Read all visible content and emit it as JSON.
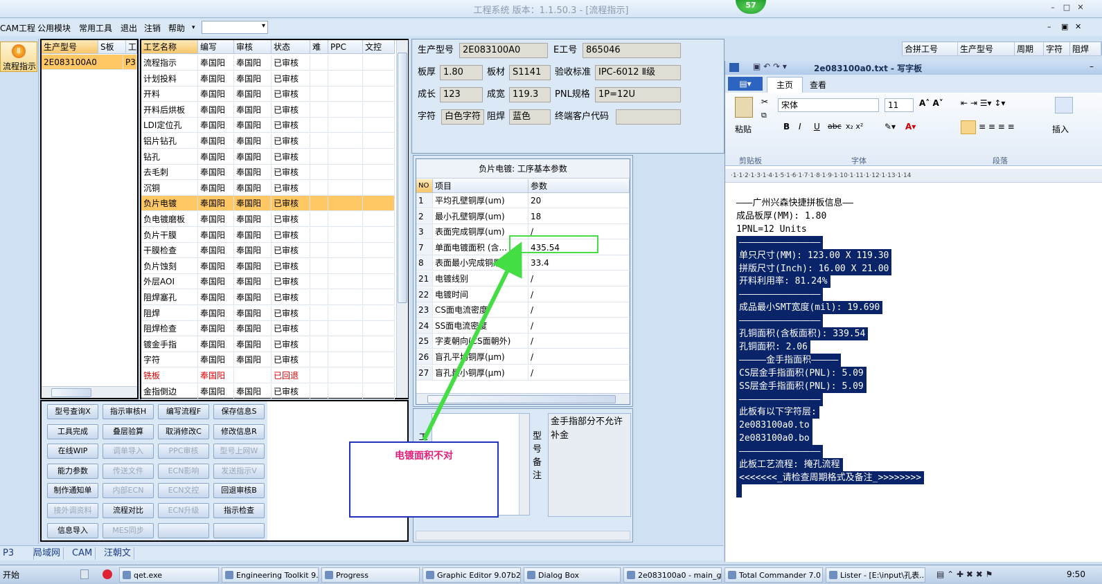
{
  "window": {
    "title": "工程系统   版本：1.1.50.3 - [流程指示]",
    "badge": "57"
  },
  "menu": {
    "items": [
      "CAM工程",
      "公用模块",
      "常用工具",
      "退出",
      "注销",
      "帮助"
    ],
    "combo_value": ""
  },
  "left_toolbar": {
    "flow_label": "流程指示"
  },
  "model_list": {
    "headers": [
      "生产型号",
      "S板",
      "工"
    ],
    "rows": [
      {
        "model": "2E083100A0",
        "s": "",
        "w": "P3"
      }
    ]
  },
  "process_table": {
    "headers": [
      "工艺名称",
      "编写",
      "审核",
      "状态",
      "难",
      "PPC",
      "文控"
    ],
    "rows": [
      {
        "name": "流程指示",
        "author": "奉国阳",
        "reviewer": "奉国阳",
        "status": "已审核"
      },
      {
        "name": "计划投料",
        "author": "奉国阳",
        "reviewer": "奉国阳",
        "status": "已审核"
      },
      {
        "name": "开料",
        "author": "奉国阳",
        "reviewer": "奉国阳",
        "status": "已审核"
      },
      {
        "name": "开料后烘板",
        "author": "奉国阳",
        "reviewer": "奉国阳",
        "status": "已审核"
      },
      {
        "name": "LDI定位孔",
        "author": "奉国阳",
        "reviewer": "奉国阳",
        "status": "已审核"
      },
      {
        "name": "铝片钻孔",
        "author": "奉国阳",
        "reviewer": "奉国阳",
        "status": "已审核"
      },
      {
        "name": "钻孔",
        "author": "奉国阳",
        "reviewer": "奉国阳",
        "status": "已审核"
      },
      {
        "name": "去毛刺",
        "author": "奉国阳",
        "reviewer": "奉国阳",
        "status": "已审核"
      },
      {
        "name": "沉铜",
        "author": "奉国阳",
        "reviewer": "奉国阳",
        "status": "已审核"
      },
      {
        "name": "负片电镀",
        "author": "奉国阳",
        "reviewer": "奉国阳",
        "status": "已审核"
      },
      {
        "name": "负电镀磨板",
        "author": "奉国阳",
        "reviewer": "奉国阳",
        "status": "已审核"
      },
      {
        "name": "负片干膜",
        "author": "奉国阳",
        "reviewer": "奉国阳",
        "status": "已审核"
      },
      {
        "name": "干膜检查",
        "author": "奉国阳",
        "reviewer": "奉国阳",
        "status": "已审核"
      },
      {
        "name": "负片蚀刻",
        "author": "奉国阳",
        "reviewer": "奉国阳",
        "status": "已审核"
      },
      {
        "name": "外层AOI",
        "author": "奉国阳",
        "reviewer": "奉国阳",
        "status": "已审核"
      },
      {
        "name": "阻焊塞孔",
        "author": "奉国阳",
        "reviewer": "奉国阳",
        "status": "已审核"
      },
      {
        "name": "阻焊",
        "author": "奉国阳",
        "reviewer": "奉国阳",
        "status": "已审核"
      },
      {
        "name": "阻焊检查",
        "author": "奉国阳",
        "reviewer": "奉国阳",
        "status": "已审核"
      },
      {
        "name": "镀金手指",
        "author": "奉国阳",
        "reviewer": "奉国阳",
        "status": "已审核"
      },
      {
        "name": "字符",
        "author": "奉国阳",
        "reviewer": "奉国阳",
        "status": "已审核"
      },
      {
        "name": "铣板",
        "author": "奉国阳",
        "reviewer": "",
        "status": "已回退"
      },
      {
        "name": "金指倒边",
        "author": "奉国阳",
        "reviewer": "奉国阳",
        "status": "已审核"
      }
    ]
  },
  "buttons": [
    {
      "label": "型号查询X",
      "disabled": false
    },
    {
      "label": "指示审核H",
      "disabled": false
    },
    {
      "label": "编写流程F",
      "disabled": false
    },
    {
      "label": "保存信息S",
      "disabled": false
    },
    {
      "label": "工具完成",
      "disabled": false
    },
    {
      "label": "叠层验算",
      "disabled": false
    },
    {
      "label": "取消修改C",
      "disabled": false
    },
    {
      "label": "修改信息R",
      "disabled": false
    },
    {
      "label": "在线WIP",
      "disabled": false
    },
    {
      "label": "调单导入",
      "disabled": true
    },
    {
      "label": "PPC审核",
      "disabled": true
    },
    {
      "label": "型号上网W",
      "disabled": true
    },
    {
      "label": "能力参数",
      "disabled": false
    },
    {
      "label": "传送文件",
      "disabled": true
    },
    {
      "label": "ECN影响",
      "disabled": true
    },
    {
      "label": "发送指示V",
      "disabled": true
    },
    {
      "label": "制作通知单",
      "disabled": false
    },
    {
      "label": "内部ECN",
      "disabled": true
    },
    {
      "label": "ECN文控",
      "disabled": true
    },
    {
      "label": "回退审核B",
      "disabled": false
    },
    {
      "label": "接外调资料",
      "disabled": true
    },
    {
      "label": "流程对比",
      "disabled": false
    },
    {
      "label": "ECN升级",
      "disabled": true
    },
    {
      "label": "指示检查",
      "disabled": false
    },
    {
      "label": "信息导入",
      "disabled": false
    },
    {
      "label": "MES同步",
      "disabled": true
    },
    {
      "label": "",
      "disabled": false
    },
    {
      "label": "",
      "disabled": false
    }
  ],
  "info": {
    "model_label": "生产型号",
    "model": "2E083100A0",
    "e_label": "E工号",
    "e_no": "865046",
    "thick_label": "板厚",
    "thick": "1.80",
    "material_label": "板材",
    "material": "S1141",
    "std_label": "验收标准",
    "std": "IPC-6012 Ⅱ级",
    "len_label": "成长",
    "len": "123",
    "wid_label": "成宽",
    "wid": "119.3",
    "pnl_label": "PNL规格",
    "pnl": "1P=12U",
    "char_label": "字符",
    "char": "白色字符",
    "mask_label": "阻焊",
    "mask": "蓝色",
    "cust_label": "终端客户代码",
    "cust": ""
  },
  "params": {
    "title": "负片电镀: 工序基本参数",
    "headers": [
      "NO",
      "项目",
      "参数"
    ],
    "rows": [
      {
        "no": "1",
        "item": "平均孔壁铜厚(um)",
        "value": "20"
      },
      {
        "no": "2",
        "item": "最小孔壁铜厚(um)",
        "value": "18"
      },
      {
        "no": "3",
        "item": "表面完成铜厚(um)",
        "value": "/"
      },
      {
        "no": "7",
        "item": "单面电镀面积 (含...",
        "value": "435.54"
      },
      {
        "no": "8",
        "item": "表面最小完成铜厚(...",
        "value": "33.4"
      },
      {
        "no": "21",
        "item": "电镀线别",
        "value": "/"
      },
      {
        "no": "22",
        "item": "电镀时间",
        "value": "/"
      },
      {
        "no": "23",
        "item": "CS面电流密度",
        "value": "/"
      },
      {
        "no": "24",
        "item": "SS面电流密度",
        "value": "/"
      },
      {
        "no": "25",
        "item": "字麦朝向(CS面朝外)",
        "value": "/"
      },
      {
        "no": "26",
        "item": "盲孔平均铜厚(μm)",
        "value": "/"
      },
      {
        "no": "27",
        "item": "盲孔最小铜厚(μm)",
        "value": "/"
      }
    ]
  },
  "bottom": {
    "work_label": "工",
    "remark_label": "型号备注",
    "remark_text": "金手指部分不允许补金"
  },
  "annotation": {
    "text": "电镀面积不对"
  },
  "right_header": [
    "合拼工号",
    "生产型号",
    "周期",
    "字符",
    "阻焊"
  ],
  "wordpad": {
    "title": "2e083100a0.txt - 写字板",
    "tabs": [
      "主页",
      "查看"
    ],
    "font": "宋体",
    "size": "11",
    "groups": [
      "剪贴板",
      "字体",
      "段落"
    ],
    "paste": "粘贴",
    "insert": "插入",
    "lines": [
      "———广州兴森快捷拼板信息——",
      "成品板厚(MM): 1.80",
      "1PNL=12 Units",
      "———————————————",
      "单只尺寸(MM): 123.00 X 119.30",
      "拼版尺寸(Inch): 16.00 X 21.00",
      "开料利用率: 81.24%",
      "———————————————",
      "成品最小SMT宽度(mil): 19.690",
      "———————————————",
      "孔铜面积(含板面积): 339.54",
      "孔铜面积: 2.06",
      "—————金手指面积—————",
      "CS层金手指面积(PNL): 5.09",
      "SS层金手指面积(PNL): 5.09",
      "———————————————",
      "此板有以下字符层:",
      "2e083100a0.to",
      "2e083100a0.bo",
      "———————————————",
      "此板工艺流程: 掩孔流程",
      "<<<<<<<_请检查周期格式及备注_>>>>>>>>"
    ]
  },
  "status": [
    "P3",
    "局域网",
    "CAM",
    "汪朝文"
  ],
  "taskbar": {
    "start": "开始",
    "tasks": [
      "qet.exe",
      "Engineering Toolkit 9....",
      "Progress",
      "Graphic Editor 9.07b2 ...",
      "Dialog Box",
      "2e083100a0 - main_ga...",
      "Total Commander 7.0 ...",
      "Lister - [E:\\input\\孔表...]"
    ],
    "clock": "9:50"
  },
  "colors": {
    "highlight": "#0a246a",
    "select_row": "#ffc864",
    "green_box": "#44dd44",
    "annotation_border": "#2233bb",
    "annotation_text": "#e0207a",
    "returned": "#dd0000"
  }
}
